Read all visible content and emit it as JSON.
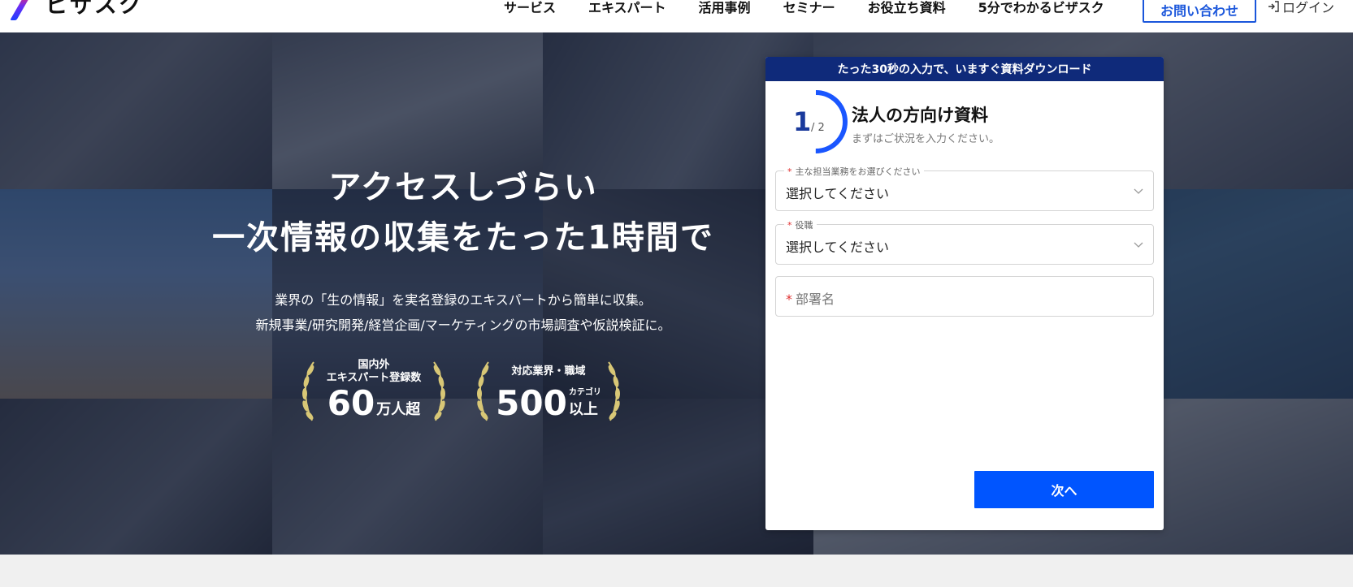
{
  "header": {
    "logo_text": "ビザスク",
    "nav": [
      "サービス",
      "エキスパート",
      "活用事例",
      "セミナー",
      "お役立ち資料",
      "5分でわかるビザスク"
    ],
    "contact_label": "お問い合わせ",
    "login_label": "ログイン"
  },
  "hero": {
    "title_line1": "アクセスしづらい",
    "title_line2": "一次情報の収集をたった1時間で",
    "sub_line1": "業界の「生の情報」を実名登録のエキスパートから簡単に収集。",
    "sub_line2": "新規事業/研究開発/経営企画/マーケティングの市場調査や仮説検証に。",
    "badge1": {
      "label_line1": "国内外",
      "label_line2": "エキスパート登録数",
      "value": "60",
      "unit": "万人超"
    },
    "badge2": {
      "label": "対応業界・職域",
      "value": "500",
      "unit_small": "カテゴリ",
      "unit": "以上"
    }
  },
  "form": {
    "banner": "たった30秒の入力で、いますぐ資料ダウンロード",
    "step_current": "1",
    "step_total": "/ 2",
    "step_progress": 0.5,
    "title": "法人の方向け資料",
    "description": "まずはご状況を入力ください。",
    "field1": {
      "label": "主な担当業務をお選びください",
      "value": "選択してください"
    },
    "field2": {
      "label": "役職",
      "value": "選択してください"
    },
    "field3": {
      "placeholder": "部署名"
    },
    "required_mark": "*",
    "next_label": "次へ"
  },
  "colors": {
    "primary": "#0055ff",
    "banner": "#0f2a7a",
    "hero_overlay": "#141c32",
    "laurel": "#d8c776"
  }
}
